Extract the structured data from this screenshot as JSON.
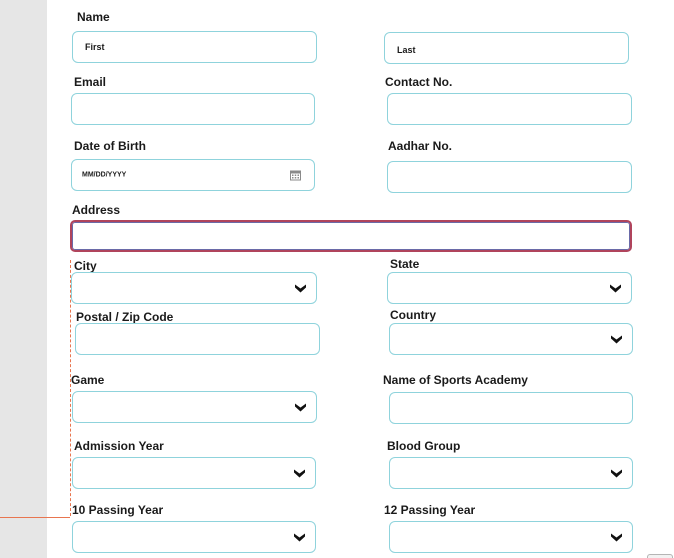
{
  "form": {
    "name": {
      "label": "Name",
      "first_placeholder": "First",
      "last_placeholder": "Last"
    },
    "email": {
      "label": "Email",
      "value": ""
    },
    "contact": {
      "label": "Contact No.",
      "value": ""
    },
    "dob": {
      "label": "Date of Birth",
      "placeholder": "MM/DD/YYYY",
      "icon": "calendar-icon"
    },
    "aadhar": {
      "label": "Aadhar No.",
      "value": ""
    },
    "address": {
      "label": "Address",
      "value": ""
    },
    "city": {
      "label": "City",
      "selected": "",
      "icon": "chevron-down-icon"
    },
    "state": {
      "label": "State",
      "selected": "",
      "icon": "chevron-down-icon"
    },
    "postal": {
      "label": "Postal / Zip Code",
      "value": ""
    },
    "country": {
      "label": "Country",
      "selected": "",
      "icon": "chevron-down-icon"
    },
    "game": {
      "label": "Game",
      "selected": "",
      "icon": "chevron-down-icon"
    },
    "academy": {
      "label": "Name of Sports Academy",
      "value": ""
    },
    "admission_year": {
      "label": "Admission Year",
      "selected": "",
      "icon": "chevron-down-icon"
    },
    "blood_group": {
      "label": "Blood Group",
      "selected": "",
      "icon": "chevron-down-icon"
    },
    "passing_10": {
      "label": "10 Passing Year",
      "selected": "",
      "icon": "chevron-down-icon"
    },
    "passing_12": {
      "label": "12 Passing Year",
      "selected": "",
      "icon": "chevron-down-icon"
    }
  },
  "colors": {
    "field_border": "#8fd3dc",
    "focus_border": "#b0445c",
    "guide_line": "#e8754f",
    "side_strip": "#e6e6e6"
  }
}
